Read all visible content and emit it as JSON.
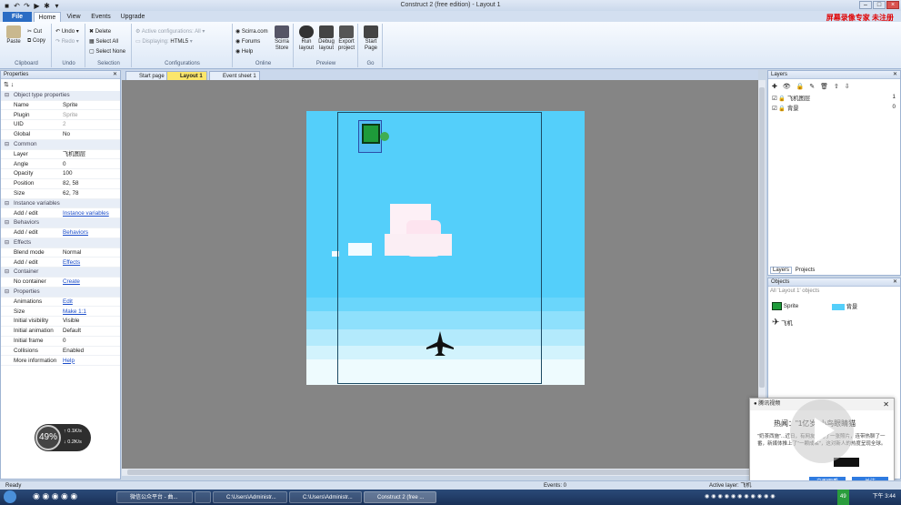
{
  "window": {
    "title": "Construct 2   (free edition) - Layout 1",
    "overlay_text": "屏幕录像专家  未注册"
  },
  "ribbon_tabs": [
    {
      "label": "File"
    },
    {
      "label": "Home"
    },
    {
      "label": "View"
    },
    {
      "label": "Events"
    },
    {
      "label": "Upgrade"
    }
  ],
  "ribbon": {
    "clipboard": {
      "paste": "Paste",
      "cut": "Cut",
      "copy": "Copy",
      "label": "Clipboard"
    },
    "undo": {
      "undo": "Undo",
      "redo": "Redo",
      "label": "Undo"
    },
    "selection": {
      "delete": "Delete",
      "select_all": "Select All",
      "select_none": "Select None",
      "label": "Selection"
    },
    "configurations": {
      "active": "Active configurations: All",
      "displaying": "Displaying:",
      "displaying_value": "HTML5",
      "label": "Configurations"
    },
    "online": {
      "scirra": "Scirra.com",
      "forums": "Forums",
      "help": "Help",
      "store_line1": "Scirra",
      "store_line2": "Store",
      "label": "Online"
    },
    "preview": {
      "run_line1": "Run",
      "run_line2": "layout",
      "debug_line1": "Debug",
      "debug_line2": "layout",
      "export_line1": "Export",
      "export_line2": "project",
      "label": "Preview"
    },
    "go": {
      "start_line1": "Start",
      "start_line2": "Page",
      "label": "Go"
    }
  },
  "properties": {
    "title": "Properties",
    "rows": [
      {
        "k": "Object type properties",
        "v": "",
        "sec": true
      },
      {
        "k": "Name",
        "v": "Sprite"
      },
      {
        "k": "Plugin",
        "v": "Sprite",
        "dim": true
      },
      {
        "k": "UID",
        "v": "2",
        "dim": true
      },
      {
        "k": "Global",
        "v": "No"
      },
      {
        "k": "Common",
        "v": "",
        "sec": true
      },
      {
        "k": "Layer",
        "v": "飞机图层"
      },
      {
        "k": "Angle",
        "v": "0"
      },
      {
        "k": "Opacity",
        "v": "100"
      },
      {
        "k": "Position",
        "v": "82, 58"
      },
      {
        "k": "Size",
        "v": "62, 78"
      },
      {
        "k": "Instance variables",
        "v": "",
        "sec": true
      },
      {
        "k": "Add / edit",
        "v": "Instance variables",
        "link": true
      },
      {
        "k": "Behaviors",
        "v": "",
        "sec": true
      },
      {
        "k": "Add / edit",
        "v": "Behaviors",
        "link": true
      },
      {
        "k": "Effects",
        "v": "",
        "sec": true
      },
      {
        "k": "Blend mode",
        "v": "Normal"
      },
      {
        "k": "Add / edit",
        "v": "Effects",
        "link": true
      },
      {
        "k": "Container",
        "v": "",
        "sec": true
      },
      {
        "k": "No container",
        "v": "Create",
        "link": true
      },
      {
        "k": "Properties",
        "v": "",
        "sec": true
      },
      {
        "k": "Animations",
        "v": "Edit",
        "link": true
      },
      {
        "k": "Size",
        "v": "Make 1:1",
        "link": true
      },
      {
        "k": "Initial visibility",
        "v": "Visible"
      },
      {
        "k": "Initial animation",
        "v": "Default"
      },
      {
        "k": "Initial frame",
        "v": "0"
      },
      {
        "k": "Collisions",
        "v": "Enabled"
      },
      {
        "k": "More information",
        "v": "Help",
        "link": true
      }
    ]
  },
  "gauge": {
    "percent": "49%",
    "up": "0.1K/s",
    "down": "0.2K/s"
  },
  "doc_tabs": [
    {
      "label": "Start page"
    },
    {
      "label": "Layout 1"
    },
    {
      "label": "Event sheet 1"
    }
  ],
  "layers": {
    "title": "Layers",
    "rows": [
      {
        "name": "飞机图层",
        "num": "1"
      },
      {
        "name": "背景",
        "num": "0"
      }
    ],
    "tab1": "Layers",
    "tab2": "Projects"
  },
  "objects": {
    "title": "Objects",
    "filter": "All 'Layout 1' objects",
    "items": [
      {
        "name": "Sprite"
      },
      {
        "name": "背景"
      },
      {
        "name": "飞机"
      }
    ]
  },
  "status": {
    "left": "Ready",
    "events": "Events: 0",
    "active_layer": "Active layer: 飞机"
  },
  "popup": {
    "brand": "腾讯视频",
    "headline": "热闻：\"1亿岁\"小鸟眼睛猫",
    "body": "\"奶茶西施\"...近日，有网友曝光了一张照片，连带热聊了一番，新媒体推上了\"一颗成名\"，这对新人的热度呈现全球。",
    "btn_watch": "立即观看",
    "btn_follow": "关注"
  },
  "taskbar": {
    "items": [
      {
        "label": "微信公众平台 - 曲..."
      },
      {
        "label": ""
      },
      {
        "label": "C:\\Users\\Administr..."
      },
      {
        "label": "C:\\Users\\Administr..."
      },
      {
        "label": "Construct 2 (free ..."
      }
    ],
    "clock": "下午 3:44",
    "cpu": "49"
  }
}
